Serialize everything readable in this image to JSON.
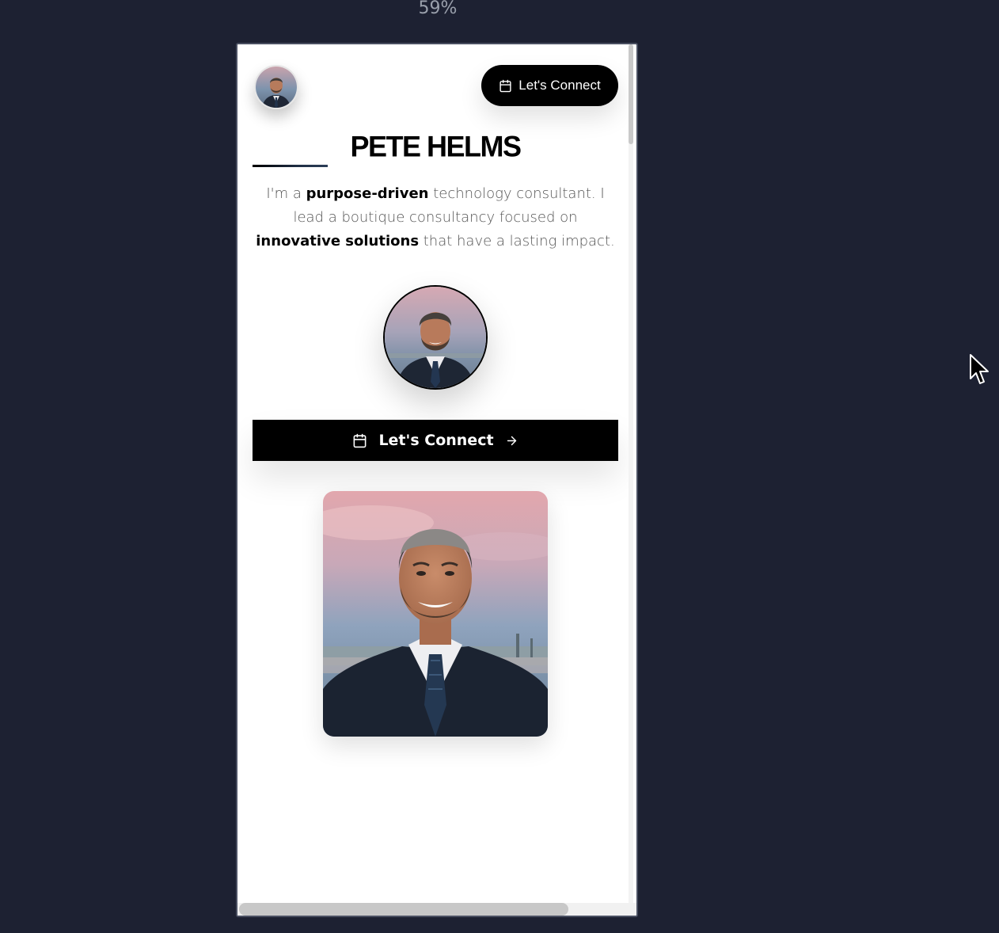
{
  "viewer": {
    "zoom": "59%"
  },
  "header": {
    "avatar_alt": "Pete Helms avatar",
    "cta_label": "Let's Connect",
    "cta_icon": "calendar-icon"
  },
  "hero": {
    "name": "PETE HELMS",
    "intro": {
      "part1": "I'm a ",
      "bold1": "purpose-driven",
      "part2": " technology consultant. I lead a boutique consultancy focused on ",
      "bold2": "innovative solutions",
      "part3": " that have a lasting impact."
    },
    "cta_label": "Let's Connect",
    "cta_icon_left": "calendar-icon",
    "cta_icon_right": "arrow-right-icon"
  },
  "colors": {
    "backdrop": "#1d2132",
    "accent": "#000000",
    "page": "#ffffff"
  }
}
